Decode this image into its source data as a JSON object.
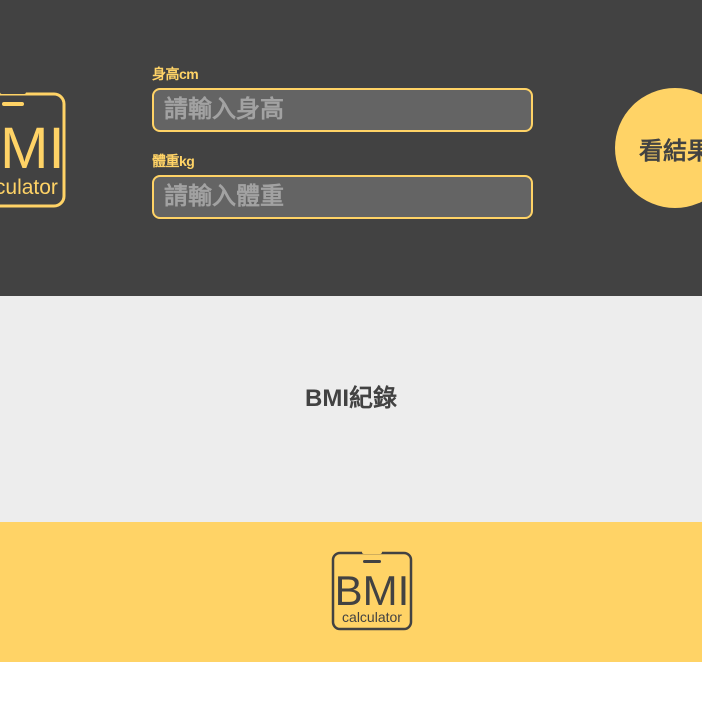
{
  "header": {
    "logo": {
      "main": "BMI",
      "sub": "calculator"
    },
    "height_field": {
      "label": "身高cm",
      "placeholder": "請輸入身高",
      "value": ""
    },
    "weight_field": {
      "label": "體重kg",
      "placeholder": "請輸入體重",
      "value": ""
    },
    "result_button_label": "看結果"
  },
  "records": {
    "title": "BMI紀錄"
  },
  "footer": {
    "logo": {
      "main": "BMI",
      "sub": "calculator"
    }
  },
  "colors": {
    "header_bg": "#424242",
    "accent": "#FFD366",
    "records_bg": "#EDEDED",
    "footer_bg": "#FFD366",
    "text_dark": "#424242"
  }
}
